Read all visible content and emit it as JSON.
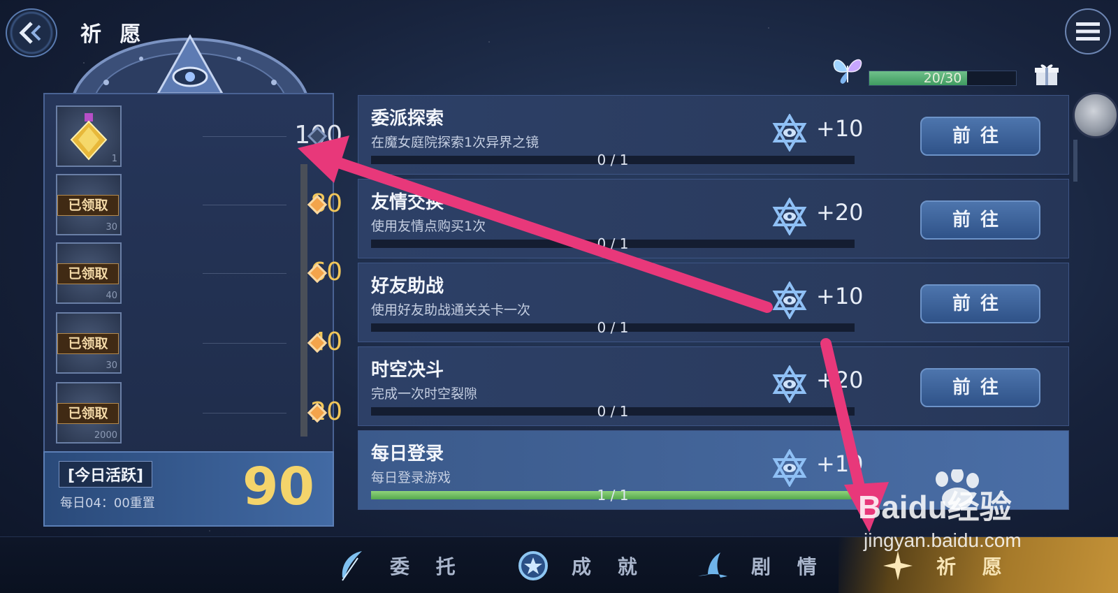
{
  "header": {
    "title": "祈 愿"
  },
  "energy": {
    "text": "20/30",
    "current": 20,
    "max": 30
  },
  "rewards": [
    {
      "value": "100",
      "claimed": false,
      "claimed_label": "",
      "count": "1"
    },
    {
      "value": "80",
      "claimed": true,
      "claimed_label": "已领取",
      "count": "30"
    },
    {
      "value": "60",
      "claimed": true,
      "claimed_label": "已领取",
      "count": "40"
    },
    {
      "value": "40",
      "claimed": true,
      "claimed_label": "已领取",
      "count": "30"
    },
    {
      "value": "20",
      "claimed": true,
      "claimed_label": "已领取",
      "count": "2000"
    }
  ],
  "activity": {
    "label": "[今日活跃]",
    "reset": "每日04：00重置",
    "value": "90"
  },
  "tasks": [
    {
      "title": "委派探索",
      "desc": "在魔女庭院探索1次异界之镜",
      "progress": "0 / 1",
      "fill": 0,
      "points": "+10",
      "button": "前往"
    },
    {
      "title": "友情交换",
      "desc": "使用友情点购买1次",
      "progress": "0 / 1",
      "fill": 0,
      "points": "+20",
      "button": "前往"
    },
    {
      "title": "好友助战",
      "desc": "使用好友助战通关关卡一次",
      "progress": "0 / 1",
      "fill": 0,
      "points": "+10",
      "button": "前往"
    },
    {
      "title": "时空决斗",
      "desc": "完成一次时空裂隙",
      "progress": "0 / 1",
      "fill": 0,
      "points": "+20",
      "button": "前往"
    },
    {
      "title": "每日登录",
      "desc": "每日登录游戏",
      "progress": "1 / 1",
      "fill": 1,
      "points": "+10",
      "button": ""
    }
  ],
  "nav": [
    {
      "label": "委 托",
      "icon": "feather-icon"
    },
    {
      "label": "成 就",
      "icon": "medal-icon"
    },
    {
      "label": "剧 情",
      "icon": "witch-hat-icon"
    },
    {
      "label": "祈 愿",
      "icon": "star-icon",
      "active": true
    }
  ],
  "watermark": {
    "brand": "Baidu经验",
    "url": "jingyan.baidu.com"
  },
  "colors": {
    "accent_gold": "#f1c65a",
    "annotation_arrow": "#e8387a",
    "progress_green": "#55a84e"
  }
}
